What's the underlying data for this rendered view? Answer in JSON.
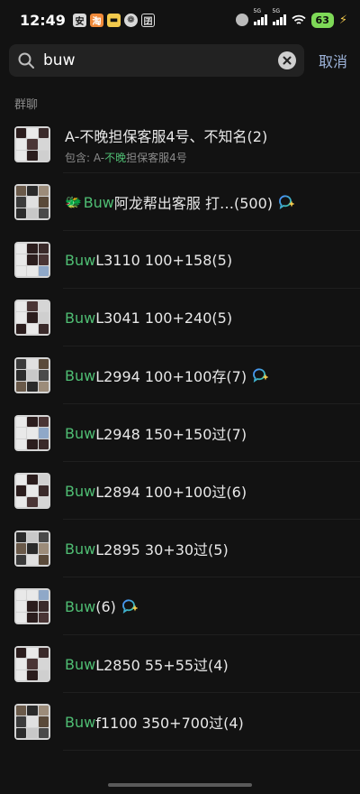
{
  "status": {
    "time": "12:49",
    "app_icons": [
      "安",
      "淘",
      "▬",
      "❁",
      "囝"
    ],
    "net1": "5G",
    "net2": "5G",
    "battery": "63"
  },
  "search": {
    "query": "buw",
    "cancel_label": "取消"
  },
  "section_label": "群聊",
  "results": [
    {
      "pre": "",
      "hl": "",
      "rest": "A-不晚担保客服4号、不知名(2)",
      "sub_pre": "包含: A-",
      "sub_hl": "不晚",
      "sub_rest": "担保客服4号",
      "badge": false,
      "emoji": ""
    },
    {
      "pre": "",
      "hl": "Buw",
      "rest": " 阿龙帮出客服 打…(500)",
      "badge": true,
      "emoji": "🐲"
    },
    {
      "pre": "",
      "hl": "Buw",
      "rest": " L3110 100+158(5)",
      "badge": false,
      "emoji": ""
    },
    {
      "pre": "",
      "hl": "Buw",
      "rest": " L3041 100+240(5)",
      "badge": false,
      "emoji": ""
    },
    {
      "pre": "",
      "hl": "Buw",
      "rest": " L2994 100+100存(7)",
      "badge": true,
      "emoji": ""
    },
    {
      "pre": "",
      "hl": "Buw",
      "rest": " L2948 150+150过(7)",
      "badge": false,
      "emoji": ""
    },
    {
      "pre": "",
      "hl": "Buw",
      "rest": " L2894 100+100过(6)",
      "badge": false,
      "emoji": ""
    },
    {
      "pre": "",
      "hl": "Buw",
      "rest": " L2895 30+30过(5)",
      "badge": false,
      "emoji": ""
    },
    {
      "pre": "",
      "hl": "Buw",
      "rest": "(6)",
      "badge": true,
      "emoji": ""
    },
    {
      "pre": "",
      "hl": "Buw",
      "rest": " L2850 55+55过(4)",
      "badge": false,
      "emoji": ""
    },
    {
      "pre": "",
      "hl": "Buw",
      "rest": " f1100 350+700过(4)",
      "badge": false,
      "emoji": ""
    }
  ],
  "colors": {
    "background": "#121212",
    "highlight": "#4fbd73",
    "cancel": "#9db3d9",
    "battery": "#7ed957"
  },
  "icons": [
    "search-icon",
    "clear-icon",
    "wifi-icon",
    "signal-icon",
    "battery-icon",
    "charging-icon",
    "chat-bubble-icon"
  ]
}
